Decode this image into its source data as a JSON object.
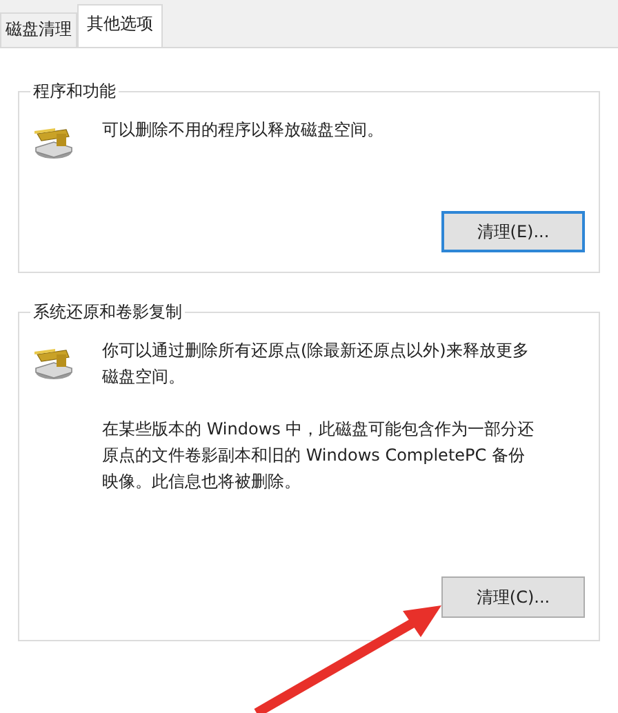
{
  "tabs": [
    {
      "label": "磁盘清理",
      "selected": false
    },
    {
      "label": "其他选项",
      "selected": true
    }
  ],
  "groups": [
    {
      "title": "程序和功能",
      "paragraphs": [
        [
          "可以删除不用的程序以释放磁盘空间。"
        ]
      ],
      "button": {
        "label": "清理(E)...",
        "focused": true
      }
    },
    {
      "title": "系统还原和卷影复制",
      "paragraphs": [
        [
          "你可以通过删除所有还原点(除最新还原点以外)来释放更多",
          "磁盘空间。"
        ],
        [
          "在某些版本的 Windows 中，此磁盘可能包含作为一部分还",
          "原点的文件卷影副本和旧的 Windows CompletePC 备份",
          "映像。此信息也将被删除。"
        ]
      ],
      "button": {
        "label": "清理(C)...",
        "focused": false
      }
    }
  ]
}
